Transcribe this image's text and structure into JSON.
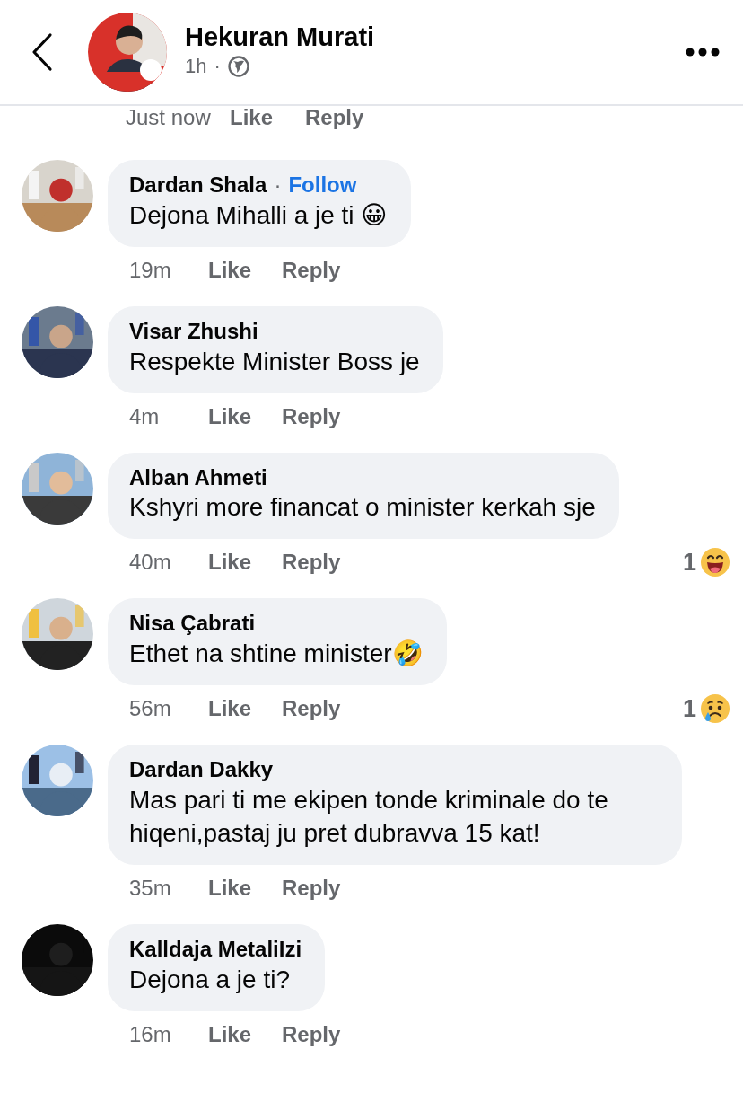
{
  "header": {
    "author": "Hekuran Murati",
    "time": "1h",
    "separator": "·"
  },
  "cut_row": {
    "time": "Just now",
    "like": "Like",
    "reply": "Reply"
  },
  "comments": [
    {
      "name": "Dardan Shala",
      "separator": "·",
      "follow": "Follow",
      "text": "Dejona Mihalli a je ti 😀",
      "time": "19m",
      "like": "Like",
      "reply": "Reply"
    },
    {
      "name": "Visar Zhushi",
      "text": "Respekte Minister Boss je",
      "time": "4m",
      "like": "Like",
      "reply": "Reply"
    },
    {
      "name": "Alban Ahmeti",
      "text": "Kshyri more financat o minister kerkah sje",
      "time": "40m",
      "like": "Like",
      "reply": "Reply",
      "reaction": {
        "count": "1",
        "kind": "haha"
      }
    },
    {
      "name": "Nisa Çabrati",
      "text": "Ethet na shtine minister🤣",
      "time": "56m",
      "like": "Like",
      "reply": "Reply",
      "reaction": {
        "count": "1",
        "kind": "sad"
      }
    },
    {
      "name": "Dardan Dakky",
      "text": "Mas pari ti me ekipen tonde kriminale do te hiqeni,pastaj ju pret dubravva 15 kat!",
      "time": "35m",
      "like": "Like",
      "reply": "Reply"
    },
    {
      "name": "Kalldaja MetaliIzi",
      "text": "Dejona a je ti?",
      "time": "16m",
      "like": "Like",
      "reply": "Reply"
    }
  ]
}
